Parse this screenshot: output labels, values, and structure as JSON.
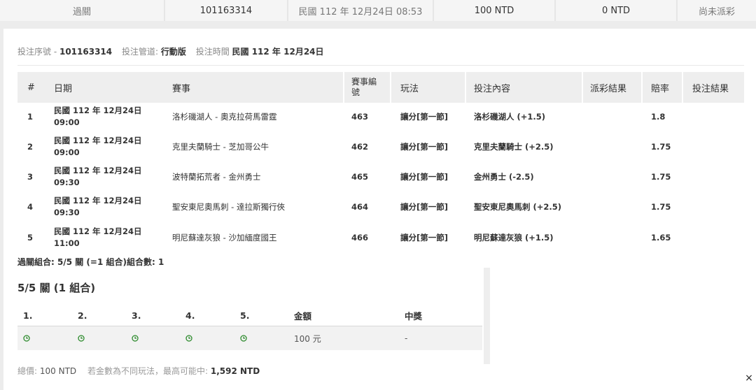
{
  "top_row": {
    "type": "過關",
    "serial": "101163314",
    "time": "民國 112 年 12月24日 08:53",
    "stake": "100 NTD",
    "payout": "0 NTD",
    "status": "尚未派彩"
  },
  "info": {
    "serial_label": "投注序號 -",
    "serial_value": "101163314",
    "channel_label": "投注管道:",
    "channel_value": "行動版",
    "time_label": "投注時間",
    "time_value": "民國 112 年 12月24日"
  },
  "bet_table": {
    "headers": [
      "#",
      "日期",
      "賽事",
      "賽事編號",
      "玩法",
      "投注內容",
      "派彩結果",
      "賠率",
      "投注結果"
    ],
    "rows": [
      {
        "no": "1",
        "date1": "民國 112 年 12月24日",
        "date2": "09:00",
        "event": "洛杉磯湖人 - 奧克拉荷馬雷霆",
        "code": "463",
        "play": "讓分[第一節]",
        "pick": "洛杉磯湖人 (+1.5)",
        "payout": "",
        "odds": "1.8",
        "result": ""
      },
      {
        "no": "2",
        "date1": "民國 112 年 12月24日",
        "date2": "09:00",
        "event": "克里夫蘭騎士 - 芝加哥公牛",
        "code": "462",
        "play": "讓分[第一節]",
        "pick": "克里夫蘭騎士 (+2.5)",
        "payout": "",
        "odds": "1.75",
        "result": ""
      },
      {
        "no": "3",
        "date1": "民國 112 年 12月24日",
        "date2": "09:30",
        "event": "波特蘭拓荒者 - 金州勇士",
        "code": "465",
        "play": "讓分[第一節]",
        "pick": "金州勇士 (-2.5)",
        "payout": "",
        "odds": "1.75",
        "result": ""
      },
      {
        "no": "4",
        "date1": "民國 112 年 12月24日",
        "date2": "09:30",
        "event": "聖安東尼奧馬刺 - 達拉斯獨行俠",
        "code": "464",
        "play": "讓分[第一節]",
        "pick": "聖安東尼奧馬刺 (+2.5)",
        "payout": "",
        "odds": "1.75",
        "result": ""
      },
      {
        "no": "5",
        "date1": "民國 112 年 12月24日",
        "date2": "11:00",
        "event": "明尼蘇達灰狼 - 沙加緬度國王",
        "code": "466",
        "play": "讓分[第一節]",
        "pick": "明尼蘇達灰狼 (+1.5)",
        "payout": "",
        "odds": "1.65",
        "result": ""
      }
    ]
  },
  "summary": "過關組合: 5/5 關 (=1 組合)組合數: 1",
  "combo": {
    "title": "5/5 關 (1 組合)",
    "headers": [
      "1.",
      "2.",
      "3.",
      "4.",
      "5.",
      "金額",
      "中獎"
    ],
    "row": {
      "amount": "100 元",
      "win": "-"
    },
    "icon": "clock-icon",
    "icon_color": "#2e8b2e"
  },
  "footer": {
    "total_label": "總價:",
    "total_value": "100 NTD",
    "note": "若金數為不同玩法，最高可能中:",
    "max_value": "1,592 NTD"
  },
  "close_label": "×"
}
